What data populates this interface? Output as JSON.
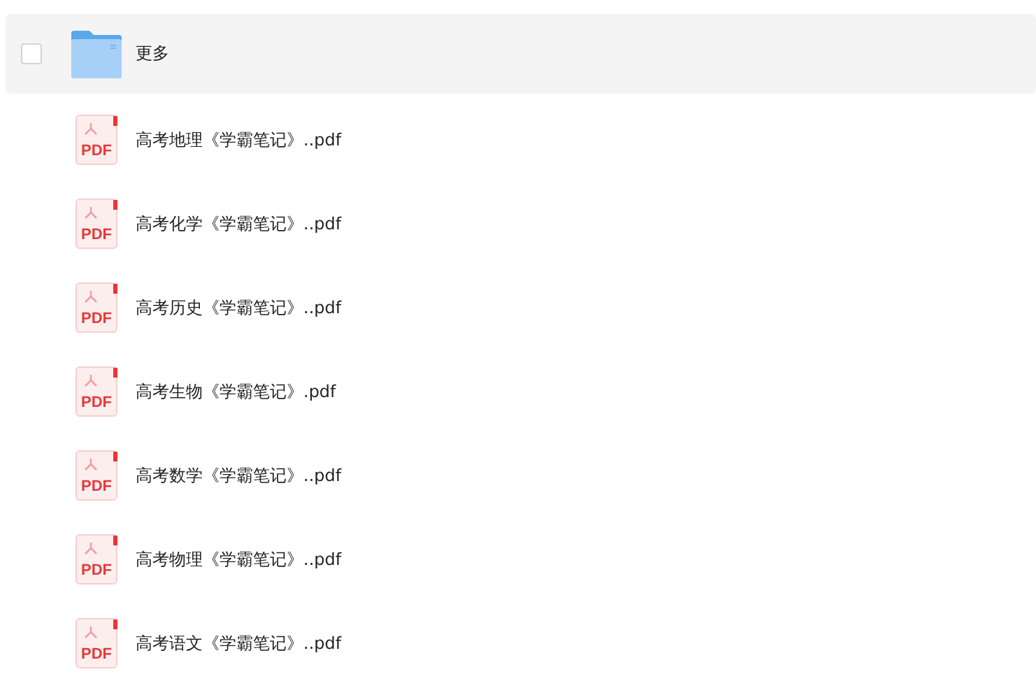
{
  "files": [
    {
      "kind": "folder",
      "name": "更多",
      "highlighted": true,
      "checked": false
    },
    {
      "kind": "pdf",
      "badge": "PDF",
      "name": "高考地理《学霸笔记》..pdf",
      "highlighted": false
    },
    {
      "kind": "pdf",
      "badge": "PDF",
      "name": "高考化学《学霸笔记》..pdf",
      "highlighted": false
    },
    {
      "kind": "pdf",
      "badge": "PDF",
      "name": "高考历史《学霸笔记》..pdf",
      "highlighted": false
    },
    {
      "kind": "pdf",
      "badge": "PDF",
      "name": "高考生物《学霸笔记》.pdf",
      "highlighted": false
    },
    {
      "kind": "pdf",
      "badge": "PDF",
      "name": "高考数学《学霸笔记》..pdf",
      "highlighted": false
    },
    {
      "kind": "pdf",
      "badge": "PDF",
      "name": "高考物理《学霸笔记》..pdf",
      "highlighted": false
    },
    {
      "kind": "pdf",
      "badge": "PDF",
      "name": "高考语文《学霸笔记》..pdf",
      "highlighted": false
    }
  ]
}
